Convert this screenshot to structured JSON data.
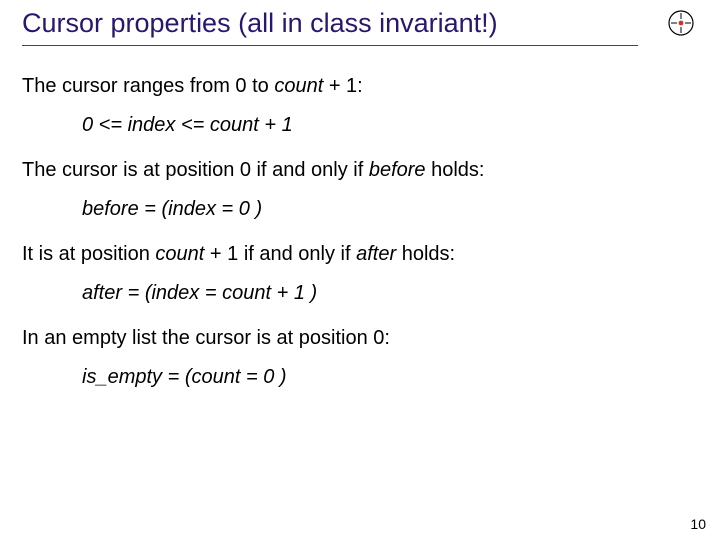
{
  "title": "Cursor properties (all in class invariant!)",
  "lines": {
    "p1a": "The cursor ranges from 0 to ",
    "p1b": "count",
    "p1c": " + 1:",
    "e1a": "0 <= ",
    "e1b": "index",
    "e1c": " <= ",
    "e1d": "count",
    "e1e": " + 1",
    "p2a": "The cursor is at position 0 if and only if ",
    "p2b": "before",
    "p2c": "  holds:",
    "e2a": "before",
    "e2b": " = (",
    "e2c": "index",
    "e2d": " = 0 )",
    "p3a": "It is at position ",
    "p3b": "count",
    "p3c": " + 1 if and only if ",
    "p3d": "after",
    "p3e": "  holds:",
    "e3a": "after",
    "e3b": " = (",
    "e3c": "index",
    "e3d": " = ",
    "e3e": "count",
    "e3f": " + 1 )",
    "p4": "In an empty list the cursor is at position 0:",
    "e4a": "is_empty",
    "e4b": " = (",
    "e4c": "count",
    "e4d": " = 0 )"
  },
  "page_number": "10"
}
